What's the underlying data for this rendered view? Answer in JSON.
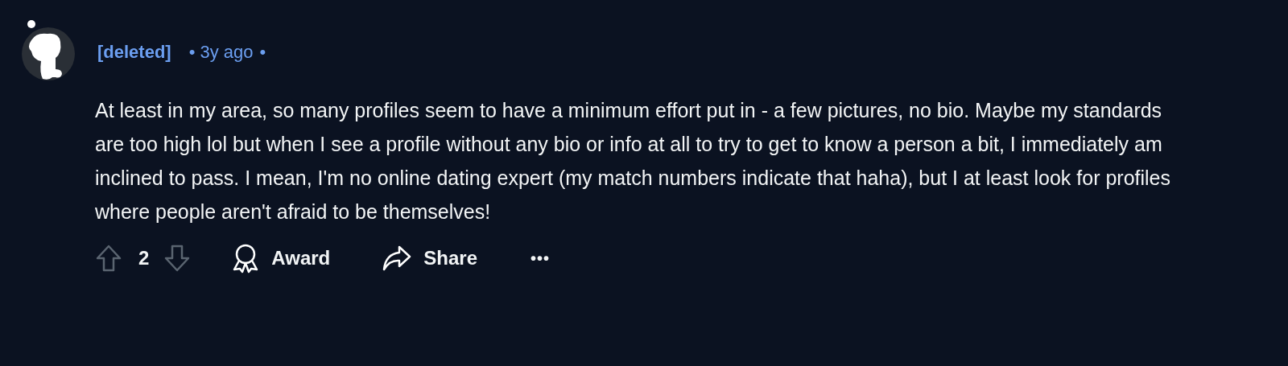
{
  "comment": {
    "author": "[deleted]",
    "separator_before": "•",
    "age": "3y ago",
    "separator_after": "•",
    "body": "At least in my area, so many profiles seem to have a minimum effort put in - a few pictures, no bio. Maybe my standards are too high lol but when I see a profile without any bio or info at all to try to get to know a person a bit, I immediately am inclined to pass. I mean, I'm no online dating expert (my match numbers indicate that haha), but I at least look for profiles where people aren't afraid to be themselves!",
    "score": "2",
    "award_label": "Award",
    "share_label": "Share",
    "more": "•••"
  }
}
